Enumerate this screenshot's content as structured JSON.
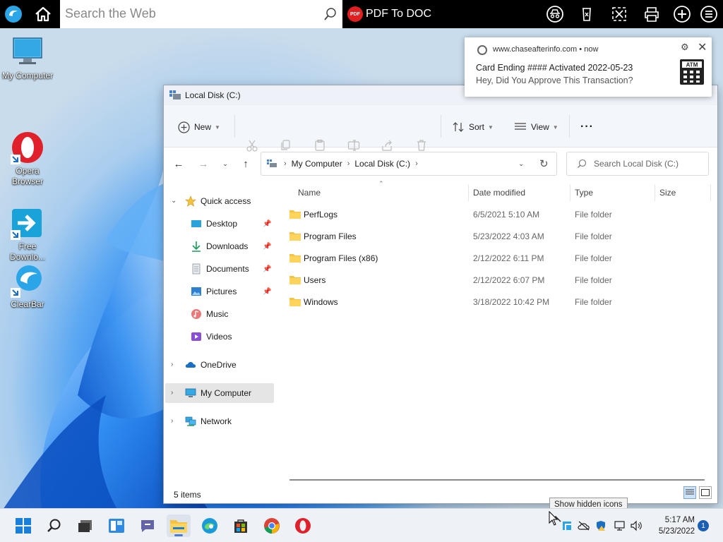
{
  "topbar": {
    "search_placeholder": "Search the Web",
    "pdf_label": "PDF To DOC",
    "pdf_badge": "PDF"
  },
  "desktop": {
    "icons": [
      {
        "label": "My Computer"
      },
      {
        "label": "Opera\nBrowser"
      },
      {
        "label": "Free\nDownlo..."
      },
      {
        "label": "ClearBar"
      }
    ]
  },
  "explorer": {
    "title": "Local Disk (C:)",
    "commands": {
      "new": "New",
      "sort": "Sort",
      "view": "View",
      "more": "···"
    },
    "breadcrumb": [
      "My Computer",
      "Local Disk (C:)"
    ],
    "search_placeholder": "Search Local Disk (C:)",
    "nav": {
      "quick_access": "Quick access",
      "quick_items": [
        {
          "label": "Desktop",
          "pinned": true
        },
        {
          "label": "Downloads",
          "pinned": true
        },
        {
          "label": "Documents",
          "pinned": true
        },
        {
          "label": "Pictures",
          "pinned": true
        },
        {
          "label": "Music",
          "pinned": false
        },
        {
          "label": "Videos",
          "pinned": false
        }
      ],
      "onedrive": "OneDrive",
      "my_computer": "My Computer",
      "network": "Network"
    },
    "columns": {
      "name": "Name",
      "date": "Date modified",
      "type": "Type",
      "size": "Size"
    },
    "rows": [
      {
        "name": "PerfLogs",
        "date": "6/5/2021 5:10 AM",
        "type": "File folder"
      },
      {
        "name": "Program Files",
        "date": "5/23/2022 4:03 AM",
        "type": "File folder"
      },
      {
        "name": "Program Files (x86)",
        "date": "2/12/2022 6:11 PM",
        "type": "File folder"
      },
      {
        "name": "Users",
        "date": "2/12/2022 6:07 PM",
        "type": "File folder"
      },
      {
        "name": "Windows",
        "date": "3/18/2022 10:42 PM",
        "type": "File folder"
      }
    ],
    "status": "5 items"
  },
  "notification": {
    "source": "www.chaseafterinfo.com",
    "time": "now",
    "line1": "Card Ending #### Activated 2022-05-23",
    "line2": "Hey, Did You Approve This Transaction?",
    "atm_label": "ATM"
  },
  "tooltip": "Show hidden icons",
  "clock": {
    "time": "5:17 AM",
    "date": "5/23/2022"
  },
  "notification_count": "1",
  "colors": {
    "accent": "#1a5fb4",
    "folder": "#f5c243",
    "opera": "#e0202a"
  }
}
